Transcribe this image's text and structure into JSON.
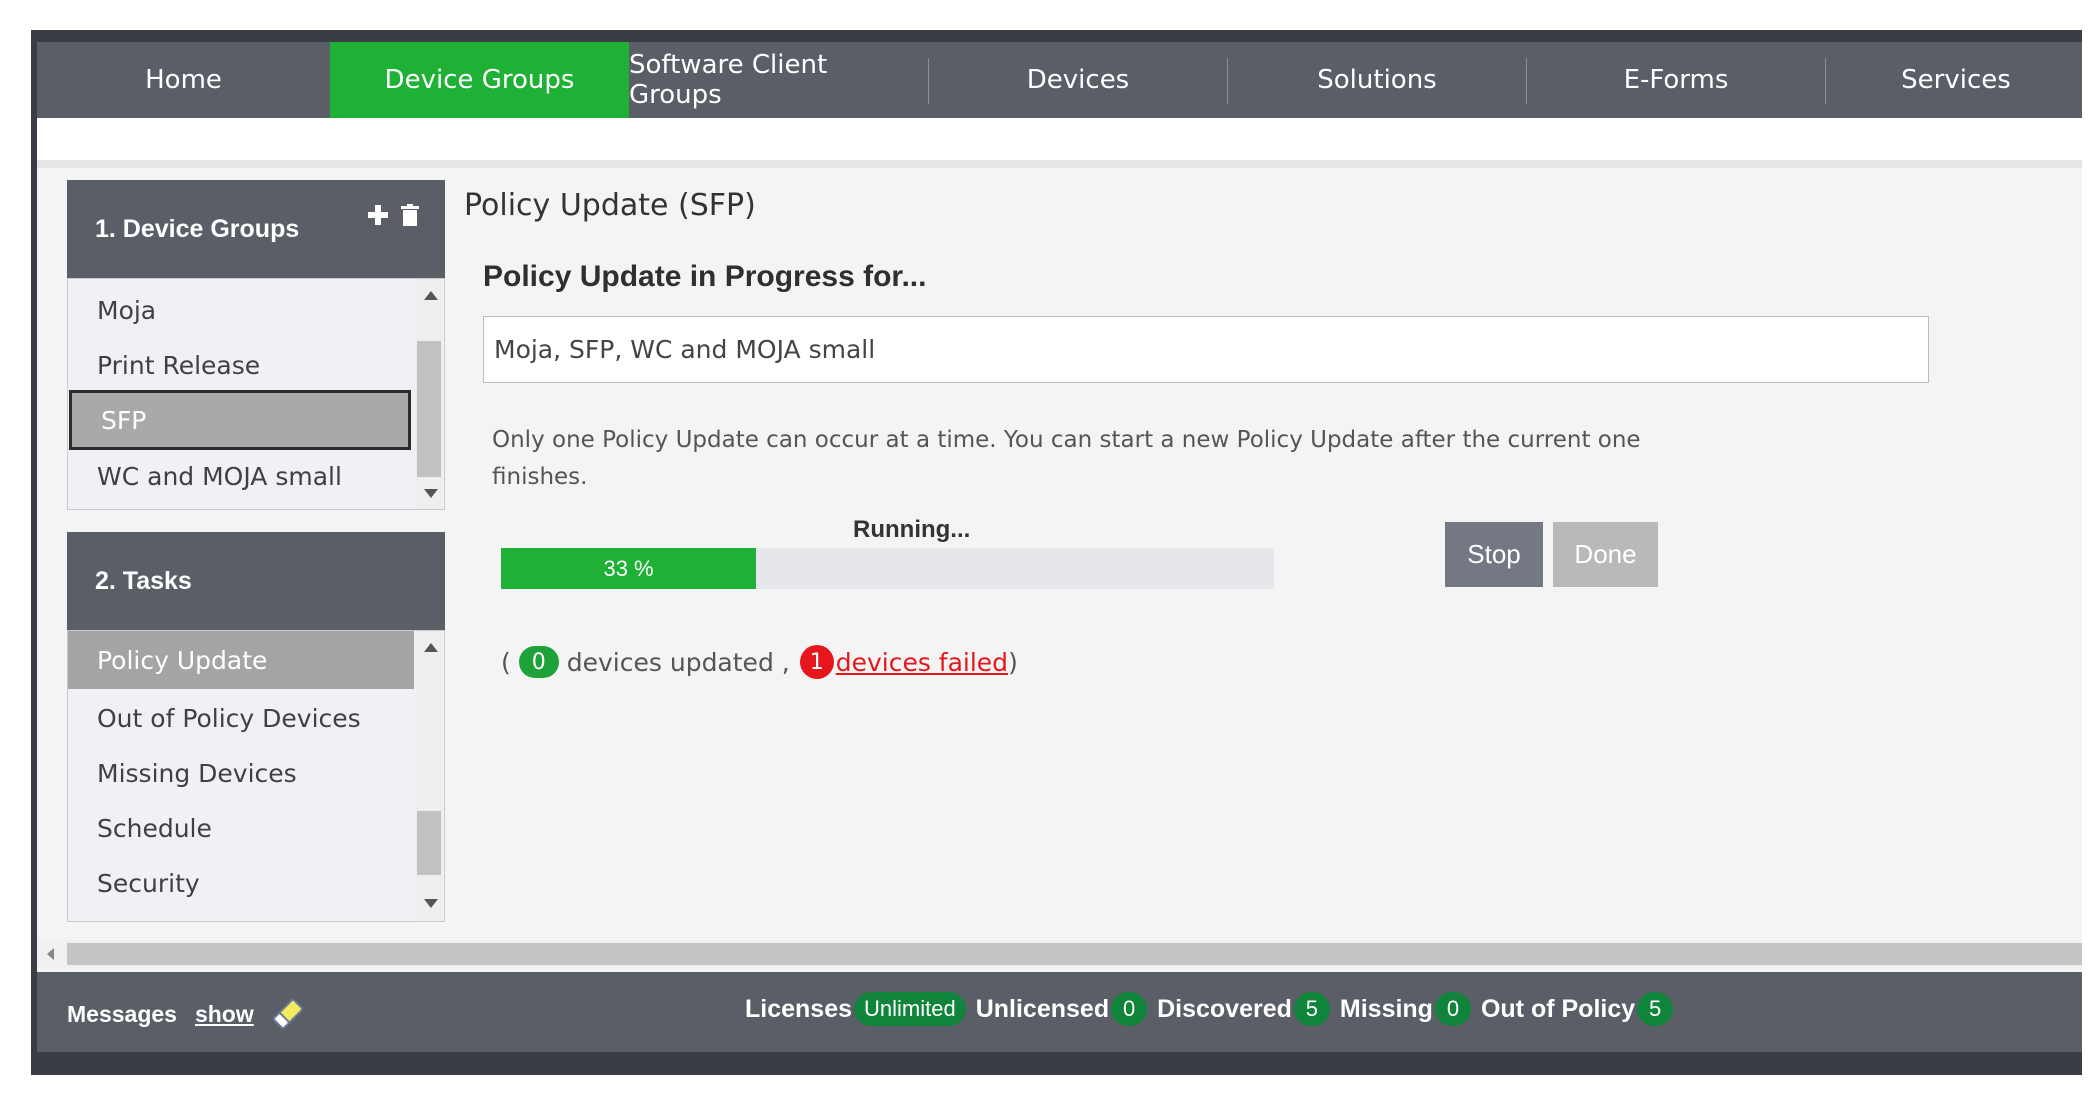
{
  "nav": {
    "tabs": [
      {
        "label": "Home"
      },
      {
        "label": "Device Groups",
        "active": true
      },
      {
        "label": "Software Client Groups"
      },
      {
        "label": "Devices"
      },
      {
        "label": "Solutions"
      },
      {
        "label": "E-Forms"
      },
      {
        "label": "Services"
      }
    ],
    "active_color": "#1fb136"
  },
  "device_groups": {
    "header": "1. Device Groups",
    "add_icon": "plus-icon",
    "delete_icon": "trash-icon",
    "items": [
      {
        "label": "Moja"
      },
      {
        "label": "Print Release"
      },
      {
        "label": "SFP",
        "selected": true
      },
      {
        "label": "WC and MOJA small"
      }
    ]
  },
  "tasks": {
    "header": "2. Tasks",
    "items": [
      {
        "label": "Policy Update",
        "selected": true
      },
      {
        "label": "Out of Policy Devices"
      },
      {
        "label": "Missing Devices"
      },
      {
        "label": "Schedule"
      },
      {
        "label": "Security"
      }
    ]
  },
  "main": {
    "page_title": "Policy Update (SFP)",
    "heading": "Policy Update in Progress for...",
    "targets": "Moja, SFP, WC and MOJA small",
    "info": "Only one Policy Update can occur at a time. You can start a new Policy Update after the current one finishes.",
    "status": "Running...",
    "progress_percent": 33,
    "progress_label": "33 %",
    "stop_label": "Stop",
    "done_label": "Done",
    "counts": {
      "open_paren": "(",
      "updated_count": "0",
      "updated_text": "devices updated ,",
      "failed_count": "1",
      "failed_text": " devices failed ",
      "close_paren": ")"
    }
  },
  "statusbar": {
    "messages_label": "Messages",
    "show_label": "show",
    "eraser_icon": "eraser-icon",
    "stats": [
      {
        "label": "Licenses",
        "value": "Unlimited"
      },
      {
        "label": "Unlicensed",
        "value": "0"
      },
      {
        "label": "Discovered",
        "value": "5"
      },
      {
        "label": "Missing",
        "value": "0"
      },
      {
        "label": "Out of Policy",
        "value": "5"
      }
    ]
  }
}
